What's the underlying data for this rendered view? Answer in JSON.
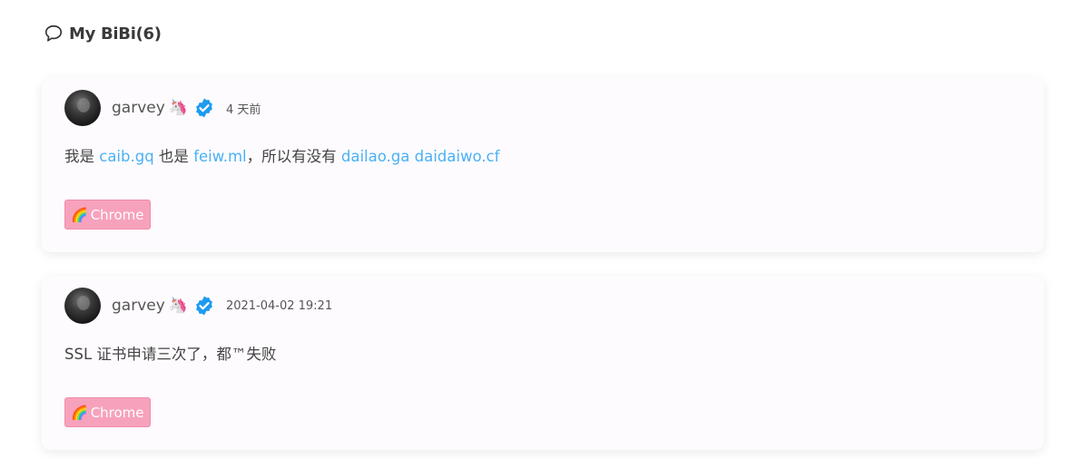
{
  "header": {
    "icon": "chat-bubble-icon",
    "title": "My BiBi(6)"
  },
  "posts": [
    {
      "username": "garvey",
      "badge_emoji": "🦄",
      "verified_icon": "verified-check-icon",
      "time": "4 天前",
      "content": {
        "t1": "我是 ",
        "l1": "caib.gq",
        "t2": " 也是 ",
        "l2": "feiw.ml",
        "t3": "，所以有没有 ",
        "l3": "dailao.ga",
        "t4": " ",
        "l4": "daidaiwo.cf"
      },
      "tag": {
        "emoji": "🌈",
        "label": "Chrome"
      }
    },
    {
      "username": "garvey",
      "badge_emoji": "🦄",
      "verified_icon": "verified-check-icon",
      "time": "2021-04-02 19:21",
      "content": {
        "t1": "SSL 证书申请三次了，都™失败"
      },
      "tag": {
        "emoji": "🌈",
        "label": "Chrome"
      }
    }
  ],
  "colors": {
    "link": "#49b1f5",
    "tag_bg": "#f7a2bd",
    "verified": "#1d9bf0"
  }
}
